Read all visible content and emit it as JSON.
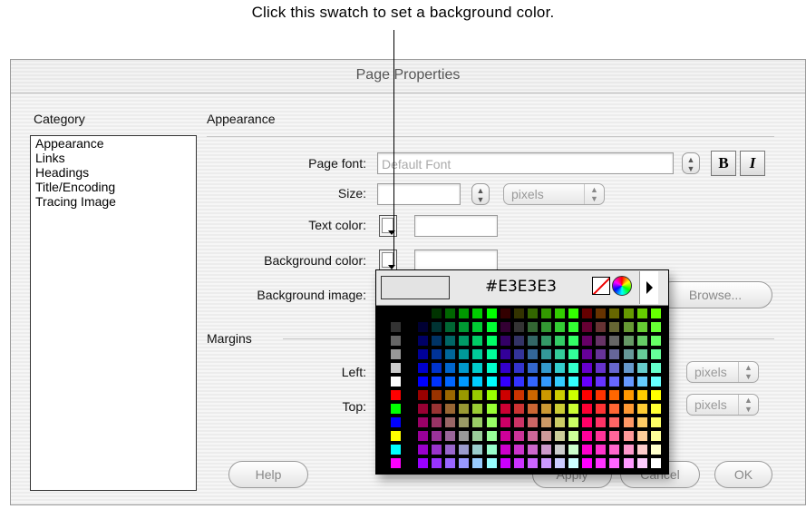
{
  "caption": "Click this swatch to set a background color.",
  "window": {
    "title": "Page Properties"
  },
  "category": {
    "header": "Category",
    "items": [
      "Appearance",
      "Links",
      "Headings",
      "Title/Encoding",
      "Tracing Image"
    ]
  },
  "appearance": {
    "header": "Appearance",
    "page_font_label": "Page font:",
    "page_font_value": "Default Font",
    "bold_label": "B",
    "italic_label": "I",
    "size_label": "Size:",
    "size_unit": "pixels",
    "text_color_label": "Text color:",
    "bg_color_label": "Background color:",
    "bg_image_label": "Background image:",
    "browse_label": "Browse..."
  },
  "margins": {
    "header": "Margins",
    "left_label": "Left:",
    "top_label": "Top:",
    "left_unit": "pixels",
    "top_unit": "pixels"
  },
  "buttons": {
    "help": "Help",
    "apply": "Apply",
    "cancel": "Cancel",
    "ok": "OK"
  },
  "picker": {
    "hex": "#E3E3E3",
    "preview_color": "#E3E3E3",
    "left_column_colors": [
      "#000000",
      "#333333",
      "#666666",
      "#999999",
      "#cccccc",
      "#ffffff",
      "#ff0000",
      "#00ff00",
      "#0000ff",
      "#ffff00",
      "#00ffff",
      "#ff00ff"
    ]
  }
}
